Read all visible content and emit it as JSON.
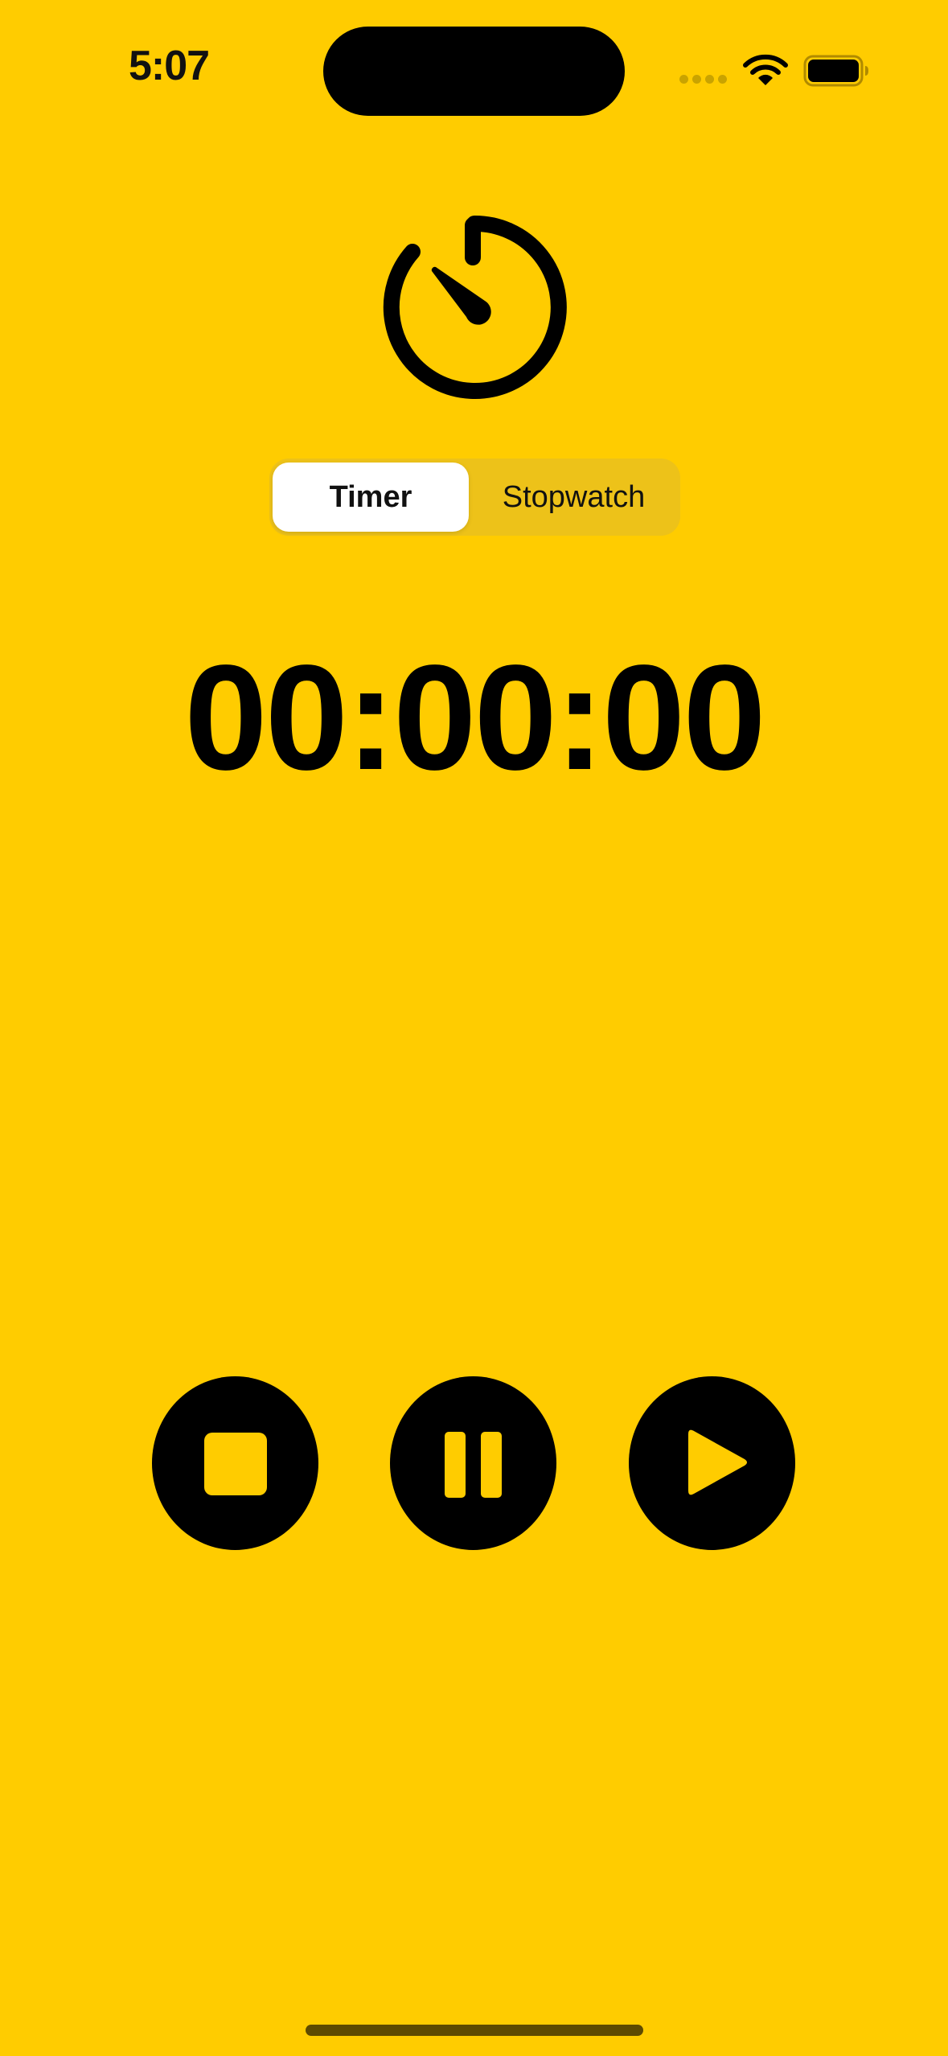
{
  "status_bar": {
    "time": "5:07",
    "wifi_icon": "wifi-icon",
    "battery_icon": "battery-icon",
    "signal_icon": "cellular-signal-icon"
  },
  "header": {
    "icon": "timer-icon"
  },
  "mode_switch": {
    "options": [
      "Timer",
      "Stopwatch"
    ],
    "selected": "Timer"
  },
  "display": {
    "time": "00:00:00"
  },
  "controls": {
    "stop_icon": "stop-icon",
    "pause_icon": "pause-icon",
    "play_icon": "play-icon"
  },
  "colors": {
    "background": "#FFCC00",
    "foreground": "#000000",
    "segment_track": "#EDC219",
    "segment_selected": "#FFFFFF"
  }
}
